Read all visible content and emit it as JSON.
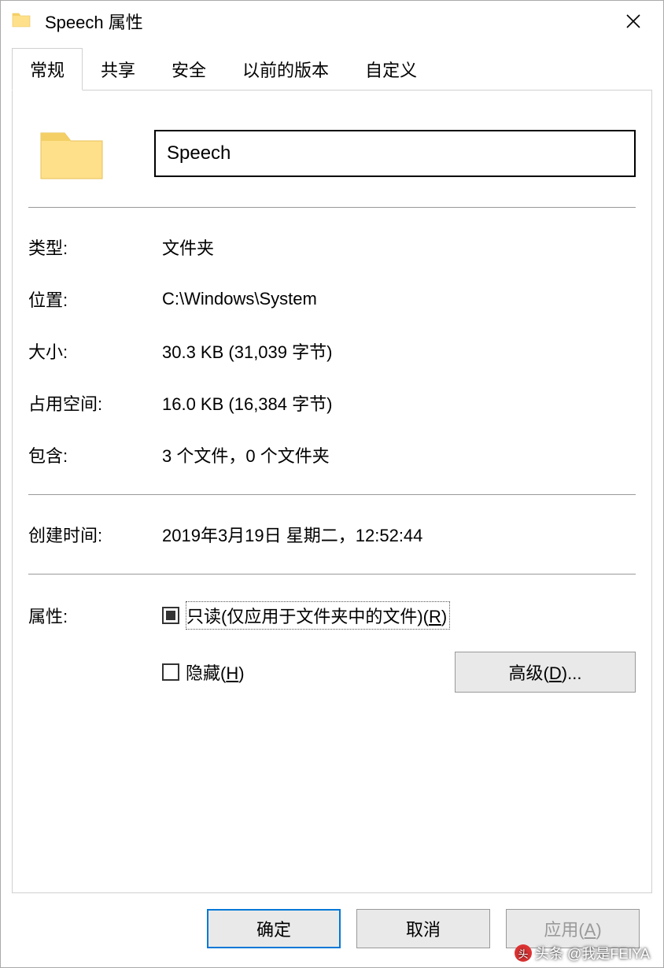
{
  "titlebar": {
    "title": "Speech 属性"
  },
  "tabs": {
    "items": [
      {
        "label": "常规",
        "active": true
      },
      {
        "label": "共享",
        "active": false
      },
      {
        "label": "安全",
        "active": false
      },
      {
        "label": "以前的版本",
        "active": false
      },
      {
        "label": "自定义",
        "active": false
      }
    ]
  },
  "general": {
    "name": "Speech",
    "type_label": "类型:",
    "type_value": "文件夹",
    "location_label": "位置:",
    "location_value": "C:\\Windows\\System",
    "size_label": "大小:",
    "size_value": "30.3 KB (31,039 字节)",
    "disk_label": "占用空间:",
    "disk_value": "16.0 KB (16,384 字节)",
    "contains_label": "包含:",
    "contains_value": "3 个文件，0 个文件夹",
    "created_label": "创建时间:",
    "created_value": "2019年3月19日 星期二，12:52:44",
    "attrs_label": "属性:",
    "readonly_prefix": "只读(仅应用于文件夹中的文件)(",
    "readonly_hotkey": "R",
    "readonly_suffix": ")",
    "hidden_prefix": "隐藏(",
    "hidden_hotkey": "H",
    "hidden_suffix": ")",
    "advanced_prefix": "高级(",
    "advanced_hotkey": "D",
    "advanced_suffix": ")..."
  },
  "buttons": {
    "ok": "确定",
    "cancel": "取消",
    "apply_prefix": "应用(",
    "apply_hotkey": "A",
    "apply_suffix": ")"
  },
  "watermark": {
    "text": "头条 @我是FEIYA"
  }
}
